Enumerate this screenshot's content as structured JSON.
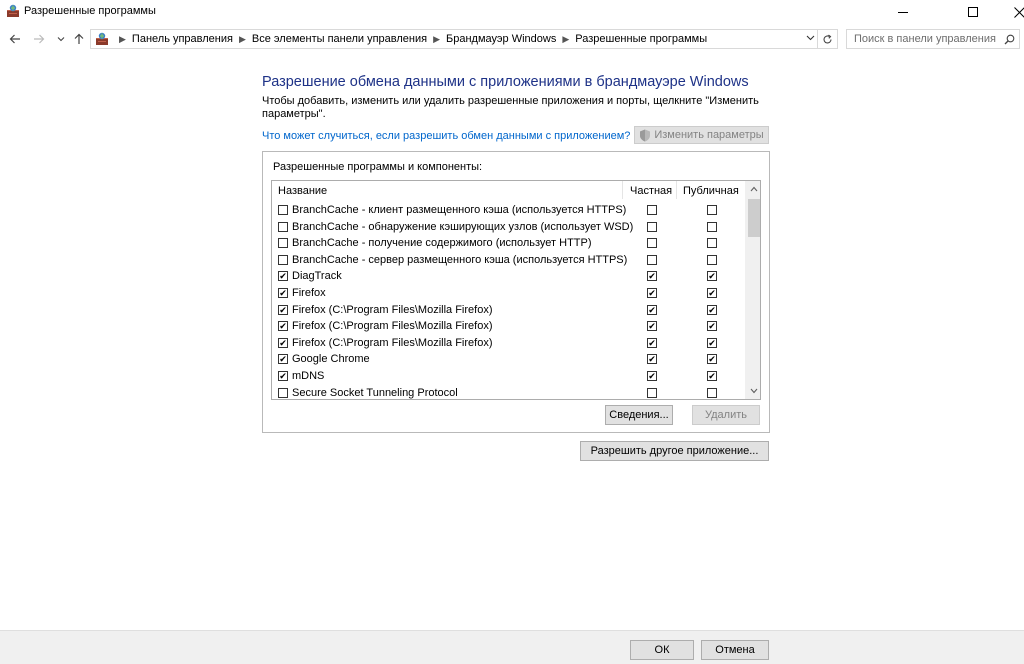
{
  "window": {
    "title": "Разрешенные программы"
  },
  "address": {
    "breadcrumbs": [
      "Панель управления",
      "Все элементы панели управления",
      "Брандмауэр Windows",
      "Разрешенные программы"
    ],
    "search_placeholder": "Поиск в панели управления"
  },
  "content": {
    "heading": "Разрешение обмена данными с приложениями в брандмауэре Windows",
    "description": "Чтобы добавить, изменить или удалить разрешенные приложения и порты, щелкните \"Изменить параметры\".",
    "help_link": "Что может случиться, если разрешить обмен данными с приложением?",
    "change_settings_label": "Изменить параметры"
  },
  "group": {
    "label": "Разрешенные программы и компоненты:",
    "columns": {
      "name": "Название",
      "private": "Частная",
      "public": "Публичная"
    },
    "rows": [
      {
        "name": "BranchCache - клиент размещенного кэша (используется HTTPS)",
        "enabled": false,
        "private": false,
        "public": false
      },
      {
        "name": "BranchCache - обнаружение кэширующих узлов (использует WSD)",
        "enabled": false,
        "private": false,
        "public": false
      },
      {
        "name": "BranchCache - получение содержимого (использует HTTP)",
        "enabled": false,
        "private": false,
        "public": false
      },
      {
        "name": "BranchCache - сервер размещенного кэша (используется HTTPS)",
        "enabled": false,
        "private": false,
        "public": false
      },
      {
        "name": "DiagTrack",
        "enabled": true,
        "private": true,
        "public": true
      },
      {
        "name": "Firefox",
        "enabled": true,
        "private": true,
        "public": true
      },
      {
        "name": "Firefox (C:\\Program Files\\Mozilla Firefox)",
        "enabled": true,
        "private": true,
        "public": true
      },
      {
        "name": "Firefox (C:\\Program Files\\Mozilla Firefox)",
        "enabled": true,
        "private": true,
        "public": true
      },
      {
        "name": "Firefox (C:\\Program Files\\Mozilla Firefox)",
        "enabled": true,
        "private": true,
        "public": true
      },
      {
        "name": "Google Chrome",
        "enabled": true,
        "private": true,
        "public": true
      },
      {
        "name": "mDNS",
        "enabled": true,
        "private": true,
        "public": true
      },
      {
        "name": "Secure Socket Tunneling Protocol",
        "enabled": false,
        "private": false,
        "public": false
      }
    ],
    "details_label": "Сведения...",
    "remove_label": "Удалить"
  },
  "allow_other_label": "Разрешить другое приложение...",
  "footer": {
    "ok_label": "ОК",
    "cancel_label": "Отмена"
  },
  "icons": {
    "app": "firewall-icon",
    "shield": "uac-shield-icon"
  }
}
